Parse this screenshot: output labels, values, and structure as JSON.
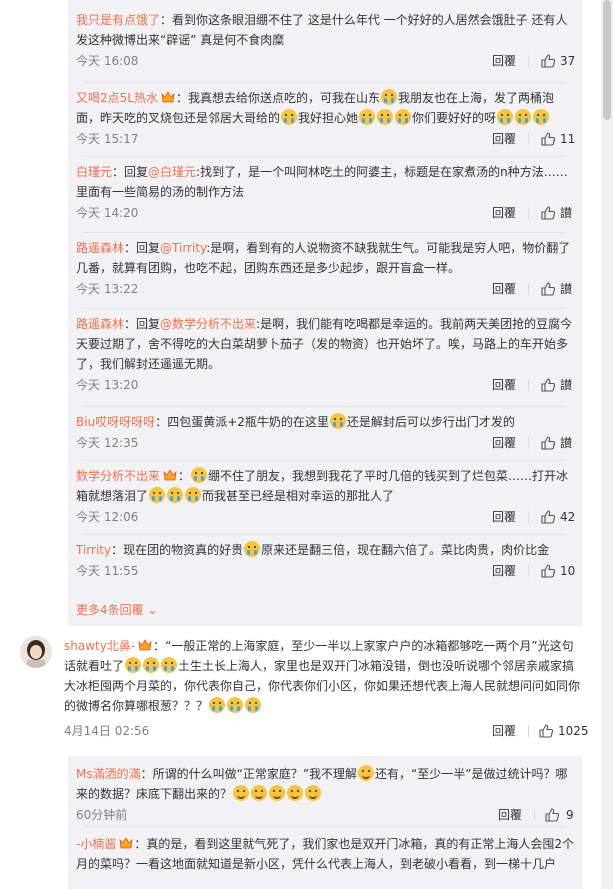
{
  "replies": [
    {
      "user": "我只是有点饿了",
      "has_badge": false,
      "parts": [
        {
          "t": "：看到你这条眼泪绷不住了 这是什么年代 一个好好的人居然会饿肚子 还有人发这种微博出来“辟谣” 真是何不食肉糜"
        }
      ],
      "time": "今天 16:08",
      "reply_label": "回覆",
      "likes": "37"
    },
    {
      "user": "又喝2点5L热水",
      "has_badge": true,
      "parts": [
        {
          "t": "：我真想去给你送点吃的，可我在山东"
        },
        {
          "e": "cry"
        },
        {
          "t": "我朋友也在上海，发了两桶泡面，昨天吃的叉烧包还是邻居大哥给的"
        },
        {
          "e": "cry"
        },
        {
          "t": "我好担心她"
        },
        {
          "e": "cry"
        },
        {
          "e": "cry"
        },
        {
          "e": "cry"
        },
        {
          "t": "你们要好好的呀"
        },
        {
          "e": "cry"
        },
        {
          "e": "cry"
        },
        {
          "e": "cry"
        }
      ],
      "time": "今天 15:17",
      "reply_label": "回覆",
      "likes": "11"
    },
    {
      "user": "白瑾元",
      "has_badge": false,
      "parts": [
        {
          "t": "：回复"
        },
        {
          "m": "@白瑾元"
        },
        {
          "t": ":找到了，是一个叫阿林吃土的阿婆主，标题是在家煮汤的n种方法……里面有一些简易的汤的制作方法"
        }
      ],
      "time": "今天 14:20",
      "reply_label": "回覆",
      "likes": "讃"
    },
    {
      "user": "路遥森林",
      "has_badge": false,
      "parts": [
        {
          "t": "：回复"
        },
        {
          "m": "@Tirrity"
        },
        {
          "t": ":是啊，看到有的人说物资不缺我就生气。可能我是穷人吧，物价翻了几番，就算有团购，也吃不起，团购东西还是多少起步，跟开盲盒一样。"
        }
      ],
      "time": "今天 13:22",
      "reply_label": "回覆",
      "likes": "讃"
    },
    {
      "user": "路遥森林",
      "has_badge": false,
      "parts": [
        {
          "t": "：回复"
        },
        {
          "m": "@数学分析不出来"
        },
        {
          "t": ":是啊，我们能有吃喝都是幸运的。我前两天美团抢的豆腐今天要过期了，舍不得吃的大白菜胡萝卜茄子（发的物资）也开始坏了。唉，马路上的车开始多了，我们解封还遥遥无期。"
        }
      ],
      "time": "今天 13:20",
      "reply_label": "回覆",
      "likes": "讃"
    },
    {
      "user": "Biu哎呀呀呀呀",
      "has_badge": false,
      "parts": [
        {
          "t": "：四包蛋黄派+2瓶牛奶的在这里"
        },
        {
          "e": "cry"
        },
        {
          "t": "还是解封后可以步行出门才发的"
        }
      ],
      "time": "今天 12:35",
      "reply_label": "回覆",
      "likes": "讃"
    },
    {
      "user": "数学分析不出来",
      "has_badge": true,
      "parts": [
        {
          "t": "："
        },
        {
          "e": "cry"
        },
        {
          "t": "绷不住了朋友，我想到我花了平时几倍的钱买到了烂包菜……打开冰箱就想落泪了"
        },
        {
          "e": "cry"
        },
        {
          "e": "cry"
        },
        {
          "e": "cry"
        },
        {
          "t": "而我甚至已经是相对幸运的那批人了"
        }
      ],
      "time": "今天 12:06",
      "reply_label": "回覆",
      "likes": "42"
    },
    {
      "user": "Tirrity",
      "has_badge": false,
      "parts": [
        {
          "t": "：现在团的物资真的好贵"
        },
        {
          "e": "cry"
        },
        {
          "t": "原来还是翻三倍，现在翻六倍了。菜比肉贵，肉价比金"
        }
      ],
      "time": "今天 11:55",
      "reply_label": "回覆",
      "likes": "10"
    }
  ],
  "more_replies": "更多4条回覆",
  "main_comment": {
    "user": "shawty北鼻-",
    "parts": [
      {
        "t": "：“一般正常的上海家庭，至少一半以上家家户户的冰箱都够吃一两个月”光这句话就看吐了"
      },
      {
        "e": "cry"
      },
      {
        "e": "cry"
      },
      {
        "e": "cry"
      },
      {
        "t": "土生土长上海人，家里也是双开门冰箱没错，倒也没听说哪个邻居亲戚家搞大冰柜囤两个月菜的，你代表你自己，你代表你们小区，你如果还想代表上海人民就想问问如同你的微博名你算哪根葱？？？"
      },
      {
        "e": "cry"
      },
      {
        "e": "cry"
      },
      {
        "e": "cry"
      }
    ],
    "time": "4月14日 02:56",
    "reply_label": "回覆",
    "likes": "1025"
  },
  "sub_replies": [
    {
      "user": "Ms滿洒的滿",
      "has_badge": false,
      "parts": [
        {
          "t": "：所谓的什么叫做“正常家庭？”我不理解"
        },
        {
          "e": "smile"
        },
        {
          "t": "还有，“至少一半”是做过统计吗？哪来的数据？床底下翻出来的？"
        },
        {
          "e": "smile"
        },
        {
          "e": "smile"
        },
        {
          "e": "smile"
        },
        {
          "e": "smile"
        },
        {
          "e": "smile"
        }
      ],
      "time": "60分钟前",
      "reply_label": "回覆",
      "likes": "9"
    },
    {
      "user": "-小楠酱",
      "has_badge": true,
      "parts": [
        {
          "t": "：真的是，看到这里就气死了，我们家也是双开门冰箱，真的有正常上海人会囤2个月的菜吗？一看这地面就知道是新小区，凭什么代表上海人，到老破小看看，到一梯十几户"
        }
      ],
      "time": "",
      "reply_label": "",
      "likes": ""
    }
  ]
}
